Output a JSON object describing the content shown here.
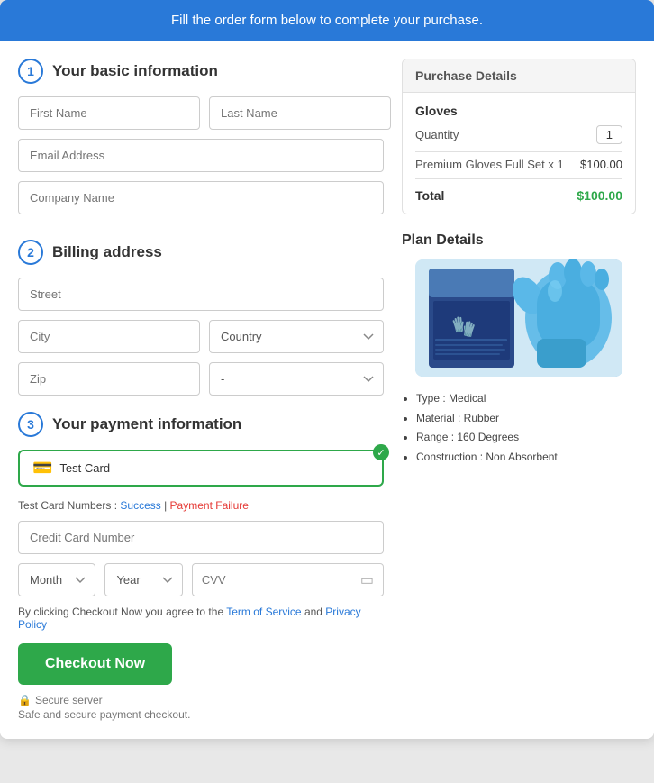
{
  "banner": {
    "text": "Fill the order form below to complete your purchase."
  },
  "sections": {
    "basic_info": {
      "number": "1",
      "title": "Your basic information",
      "first_name_placeholder": "First Name",
      "last_name_placeholder": "Last Name",
      "email_placeholder": "Email Address",
      "company_placeholder": "Company Name"
    },
    "billing": {
      "number": "2",
      "title": "Billing address",
      "street_placeholder": "Street",
      "city_placeholder": "City",
      "country_placeholder": "Country",
      "zip_placeholder": "Zip",
      "state_placeholder": "-"
    },
    "payment": {
      "number": "3",
      "title": "Your payment information",
      "card_label": "Test Card",
      "test_card_text": "Test Card Numbers :",
      "success_link": "Success",
      "pipe": " | ",
      "failure_link": "Payment Failure",
      "credit_card_placeholder": "Credit Card Number",
      "month_placeholder": "Month",
      "year_placeholder": "Year",
      "cvv_placeholder": "CVV",
      "terms_prefix": "By clicking Checkout Now you agree to the ",
      "terms_link": "Term of Service",
      "terms_mid": " and ",
      "privacy_link": "Privacy Policy",
      "checkout_label": "Checkout Now",
      "secure_label": "Secure server",
      "safe_label": "Safe and secure payment checkout."
    }
  },
  "purchase_details": {
    "header": "Purchase Details",
    "product_name": "Gloves",
    "quantity_label": "Quantity",
    "quantity_value": "1",
    "product_desc": "Premium Gloves Full Set x 1",
    "product_price": "$100.00",
    "total_label": "Total",
    "total_price": "$100.00"
  },
  "plan_details": {
    "title": "Plan Details",
    "specs": [
      "Type : Medical",
      "Material : Rubber",
      "Range : 160 Degrees",
      "Construction : Non Absorbent"
    ]
  }
}
